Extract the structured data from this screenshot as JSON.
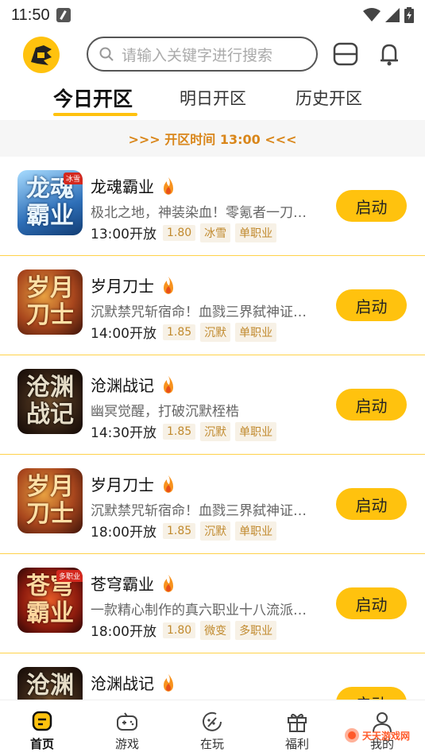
{
  "status_bar": {
    "time": "11:50"
  },
  "header": {
    "search_placeholder": "请输入关键字进行搜索"
  },
  "tabs": [
    {
      "label": "今日开区"
    },
    {
      "label": "明日开区"
    },
    {
      "label": "历史开区"
    }
  ],
  "banner": {
    "text": ">>>  开区时间 13:00  <<<"
  },
  "games": [
    {
      "title": "龙魂霸业",
      "desc": "极北之地，神装染血！零氪者一刀斩神！",
      "time": "13:00开放",
      "tags": [
        "1.80",
        "冰雪",
        "单职业"
      ],
      "button": "启动",
      "icon_text": "龙魂霸业",
      "icon_badge": "冰雪"
    },
    {
      "title": "岁月刀士",
      "desc": "沉默禁咒斩宿命！血戮三界弑神证道！",
      "time": "14:00开放",
      "tags": [
        "1.85",
        "沉默",
        "单职业"
      ],
      "button": "启动",
      "icon_text": "岁月刀士",
      "icon_badge": ""
    },
    {
      "title": "沧渊战记",
      "desc": "幽冥觉醒，打破沉默桎梏",
      "time": "14:30开放",
      "tags": [
        "1.85",
        "沉默",
        "单职业"
      ],
      "button": "启动",
      "icon_text": "沧渊战记",
      "icon_badge": ""
    },
    {
      "title": "岁月刀士",
      "desc": "沉默禁咒斩宿命！血戮三界弑神证道！",
      "time": "18:00开放",
      "tags": [
        "1.85",
        "沉默",
        "单职业"
      ],
      "button": "启动",
      "icon_text": "岁月刀士",
      "icon_badge": ""
    },
    {
      "title": "苍穹霸业",
      "desc": "一款精心制作的真六职业十八流派传奇",
      "time": "18:00开放",
      "tags": [
        "1.80",
        "微变",
        "多职业"
      ],
      "button": "启动",
      "icon_text": "苍穹霸业",
      "icon_badge": "多职业"
    },
    {
      "title": "沧渊战记",
      "desc": "",
      "time": "",
      "tags": [],
      "button": "启动",
      "icon_text": "沧渊战记",
      "icon_badge": ""
    }
  ],
  "bottom_nav": [
    {
      "label": "首页",
      "icon": "home-icon"
    },
    {
      "label": "游戏",
      "icon": "gamepad-icon"
    },
    {
      "label": "在玩",
      "icon": "playing-icon"
    },
    {
      "label": "福利",
      "icon": "gift-icon"
    },
    {
      "label": "我的",
      "icon": "user-icon"
    }
  ],
  "watermark": {
    "text": "天天游戏网"
  },
  "colors": {
    "accent": "#ffc20e",
    "tag_text": "#c18a2e",
    "banner_text": "#d9861a"
  }
}
